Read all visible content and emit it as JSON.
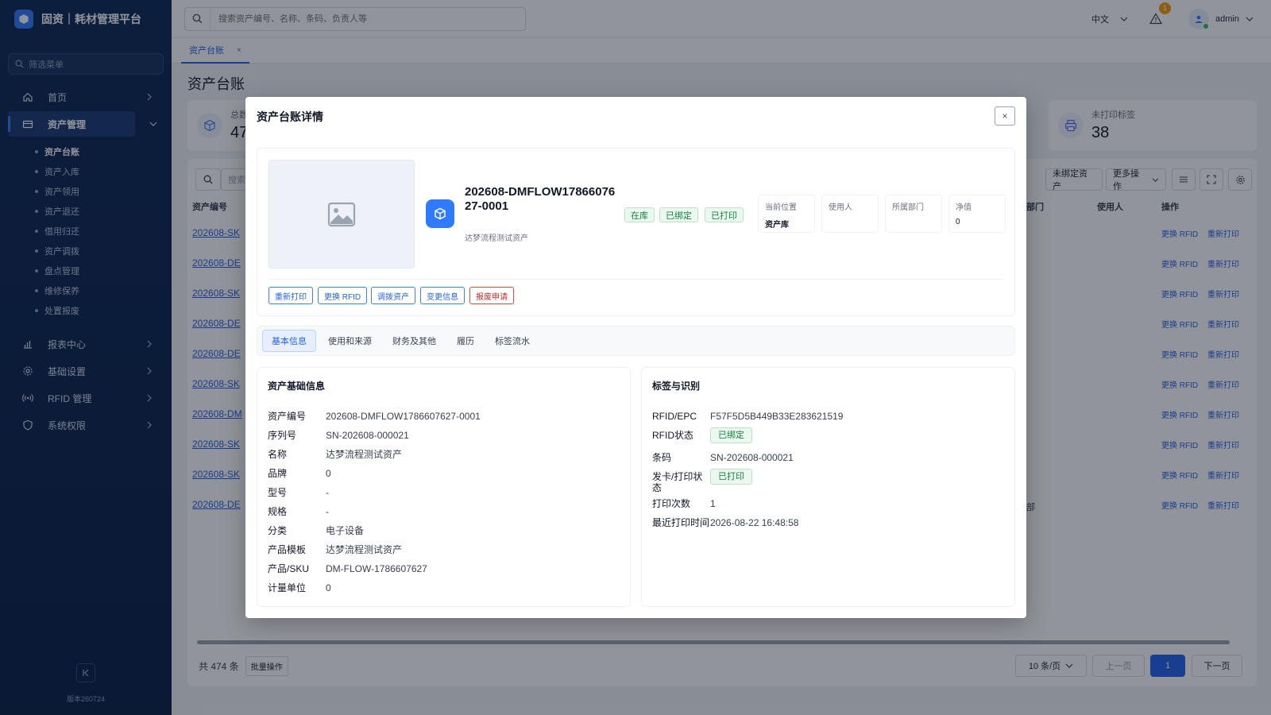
{
  "app": {
    "brand": "固资｜耗材管理平台",
    "version": "版本260724"
  },
  "sidebar": {
    "filter_placeholder": "筛选菜单",
    "items": [
      {
        "label": "首页"
      },
      {
        "label": "资产管理"
      },
      {
        "label": "报表中心"
      },
      {
        "label": "基础设置"
      },
      {
        "label": "RFID 管理"
      },
      {
        "label": "系统权限"
      }
    ],
    "sub_items": [
      "资产台账",
      "资产入库",
      "资产领用",
      "资产退还",
      "借用归还",
      "资产调拨",
      "盘点管理",
      "维修保养",
      "处置报废"
    ]
  },
  "topbar": {
    "search_placeholder": "搜索资产编号、名称、条码、负责人等",
    "language": "中文",
    "alert_count": "1",
    "username": "admin"
  },
  "page_tab": {
    "label": "资产台账",
    "close": "×"
  },
  "page": {
    "title": "资产台账",
    "stat_left": {
      "label": "总数",
      "value": "47"
    },
    "stat_right": {
      "label": "未打印标签",
      "value": "38"
    }
  },
  "table": {
    "search_placeholder": "搜索",
    "toolbar": {
      "unbound": "未绑定资产",
      "more": "更多操作"
    },
    "headers": {
      "asset_no": "资产编号",
      "dept": "部门",
      "user": "使用人",
      "ops": "操作"
    },
    "rows": [
      {
        "no": "202608-SK",
        "dept": ""
      },
      {
        "no": "202608-DE",
        "dept": ""
      },
      {
        "no": "202608-SK",
        "dept": ""
      },
      {
        "no": "202608-DE",
        "dept": ""
      },
      {
        "no": "202608-DE",
        "dept": ""
      },
      {
        "no": "202608-SK",
        "dept": ""
      },
      {
        "no": "202608-DM",
        "dept": ""
      },
      {
        "no": "202608-SK",
        "dept": ""
      },
      {
        "no": "202608-SK",
        "dept": ""
      },
      {
        "no": "202608-DE",
        "dept": "部"
      }
    ],
    "action_rfid": "更换 RFID",
    "action_reprint": "重新打印"
  },
  "pager": {
    "total": "共 474 条",
    "bulk": "批量操作",
    "page_size": "10 条/页",
    "prev": "上一页",
    "current": "1",
    "next": "下一页"
  },
  "modal": {
    "title": "资产台账详情",
    "close": "×",
    "asset_no": "202608-DMFLOW1786607627-0001",
    "asset_name": "达梦流程测试资产",
    "tags": [
      "在库",
      "已绑定",
      "已打印"
    ],
    "info": [
      {
        "label": "当前位置",
        "value": "资产库"
      },
      {
        "label": "使用人",
        "value": ""
      },
      {
        "label": "所属部门",
        "value": ""
      },
      {
        "label": "净值",
        "value": "0"
      }
    ],
    "actions": [
      "重新打印",
      "更换 RFID",
      "调拨资产",
      "变更信息",
      "报废申请"
    ],
    "tabs": [
      "基本信息",
      "使用和来源",
      "财务及其他",
      "履历",
      "标签流水"
    ],
    "basic": {
      "title": "资产基础信息",
      "fields": [
        {
          "k": "资产编号",
          "v": "202608-DMFLOW1786607627-0001"
        },
        {
          "k": "序列号",
          "v": "SN-202608-000021"
        },
        {
          "k": "名称",
          "v": "达梦流程测试资产"
        },
        {
          "k": "品牌",
          "v": "0"
        },
        {
          "k": "型号",
          "v": "-"
        },
        {
          "k": "规格",
          "v": "-"
        },
        {
          "k": "分类",
          "v": "电子设备"
        },
        {
          "k": "产品模板",
          "v": "达梦流程测试资产"
        },
        {
          "k": "产品/SKU",
          "v": "DM-FLOW-1786607627"
        },
        {
          "k": "计量单位",
          "v": "0"
        }
      ]
    },
    "label": {
      "title": "标签与识别",
      "rfid_k": "RFID/EPC",
      "rfid_v": "F57F5D5B449B33E283621519",
      "rfid_status_k": "RFID状态",
      "rfid_status_v": "已绑定",
      "barcode_k": "条码",
      "barcode_v": "SN-202608-000021",
      "print_status_k": "发卡/打印状态",
      "print_status_v": "已打印",
      "print_count_k": "打印次数",
      "print_count_v": "1",
      "last_print_k": "最近打印时间",
      "last_print_v": "2026-08-22 16:48:58"
    }
  }
}
